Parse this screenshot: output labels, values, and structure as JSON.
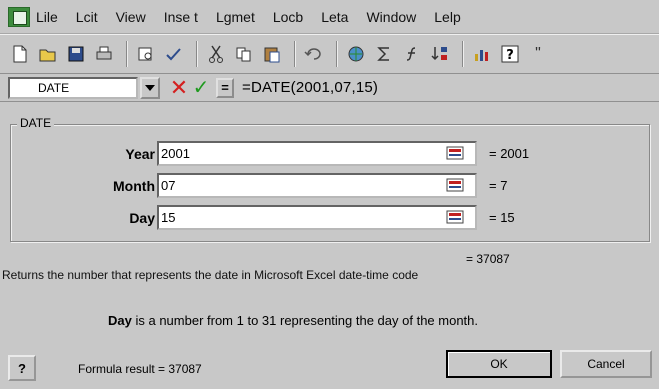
{
  "menubar": {
    "items": [
      "Lile",
      "Lcit",
      "View",
      "Inse t",
      "Lgmet",
      "Locb",
      "Leta",
      "Window",
      "Lelp"
    ]
  },
  "toolbar": {
    "tools": [
      "new-icon",
      "open-icon",
      "save-icon",
      "print-icon",
      "print-preview-icon",
      "spell-icon",
      "cut-icon",
      "copy-icon",
      "paste-icon",
      "undo-icon",
      "hyperlink-icon",
      "autosum-icon",
      "function-icon",
      "sort-icon",
      "chart-icon",
      "help-icon"
    ],
    "overflow": "\""
  },
  "formula_bar": {
    "name_box": "DATE",
    "equals": "=",
    "formula": "=DATE(2001,07,15)",
    "cancel_color": "#d42020",
    "ok_color": "#1f9a1f"
  },
  "function_args": {
    "group_label": "DATE",
    "rows": [
      {
        "label": "Year",
        "value": "2001",
        "result": "= 2001"
      },
      {
        "label": "Month",
        "value": "07",
        "result": "= 7"
      },
      {
        "label": "Day",
        "value": "15",
        "result": "= 15"
      }
    ],
    "result": "= 37087",
    "description": "Returns the number that represents the date in Microsoft Excel date-time code",
    "help_name": "Day",
    "help_text": "is a number from 1 to 31 representing the day of the month."
  },
  "footer": {
    "help_label": "?",
    "formula_result": "Formula result = 37087",
    "ok_label": "OK",
    "cancel_label": "Cancel"
  }
}
